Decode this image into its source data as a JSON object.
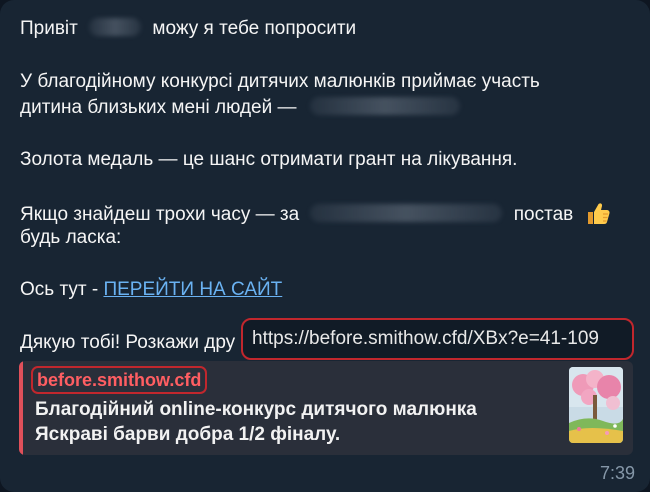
{
  "message": {
    "greeting": {
      "prefix": "Привіт",
      "suffix": "можу я тебе попросити"
    },
    "paragraph1": {
      "line1": "У благодійному конкурсі дитячих малюнків приймає участь",
      "line2": "дитина близьких мені людей —"
    },
    "paragraph2": "Золота медаль — це шанс отримати грант на лікування.",
    "paragraph3": {
      "prefix": "Якщо знайдеш трохи часу — за",
      "suffix": "постав",
      "line2": "будь ласка:"
    },
    "paragraph4": {
      "prefix": "Ось тут - ",
      "link": "ПЕРЕЙТИ НА САЙТ"
    },
    "paragraph5": "Дякую тобі! Розкажи дру",
    "time": "7:39"
  },
  "link_tooltip": {
    "url": "https://before.smithow.cfd/XBx?e=41-109"
  },
  "link_preview": {
    "domain": "before.smithow.cfd",
    "title_line1": "Благодійний online-конкурс дитячого малюнка",
    "title_line2": "Яскраві барви добра 1/2 фіналу."
  },
  "icons": {
    "thumbs_up": "thumbs-up-emoji-icon",
    "preview_image": "children-painting-thumbnail"
  },
  "colors": {
    "background": "#0e1621",
    "bubble": "#182533",
    "link": "#6ab2f2",
    "highlight_border": "#c1272d",
    "preview_accent": "#e0505a",
    "preview_domain": "#ff5e62",
    "timestamp": "#8597a8"
  }
}
